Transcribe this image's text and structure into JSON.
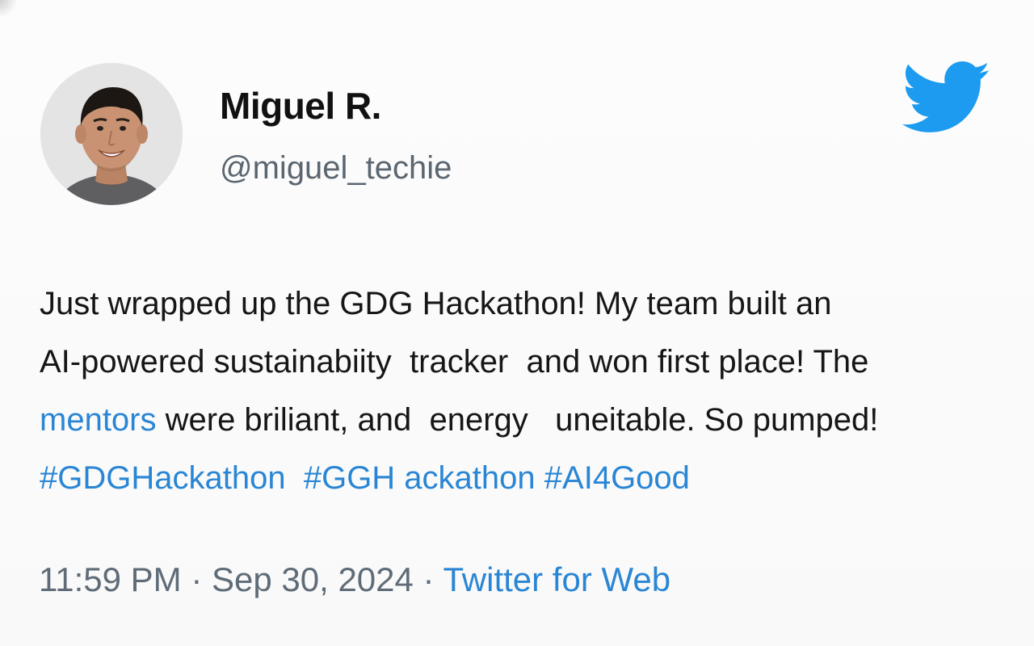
{
  "tweet": {
    "author": {
      "display_name": "Miguel R.",
      "handle": "@miguel_techie"
    },
    "body": {
      "line1": "Just wrapped up the GDG Hackathon! My team built an",
      "line2": "AI-powered sustainabiity  tracker  and won first place! The",
      "line3_link": "mentors",
      "line3_rest": " were briliant, and  energy   uneitable. So pumped!",
      "hashtags": [
        "#GDGHackathon",
        "#GGH ackathon",
        "#AI4Good"
      ]
    },
    "meta": {
      "time": "11:59 PM",
      "separator": " · ",
      "date": "Sep 30, 2024",
      "source": "Twitter for Web"
    }
  },
  "icons": {
    "brand": "twitter-bird-icon"
  },
  "colors": {
    "link": "#2a86d4",
    "brand_blue": "#1d9bf0",
    "secondary_text": "#5f6c78"
  }
}
